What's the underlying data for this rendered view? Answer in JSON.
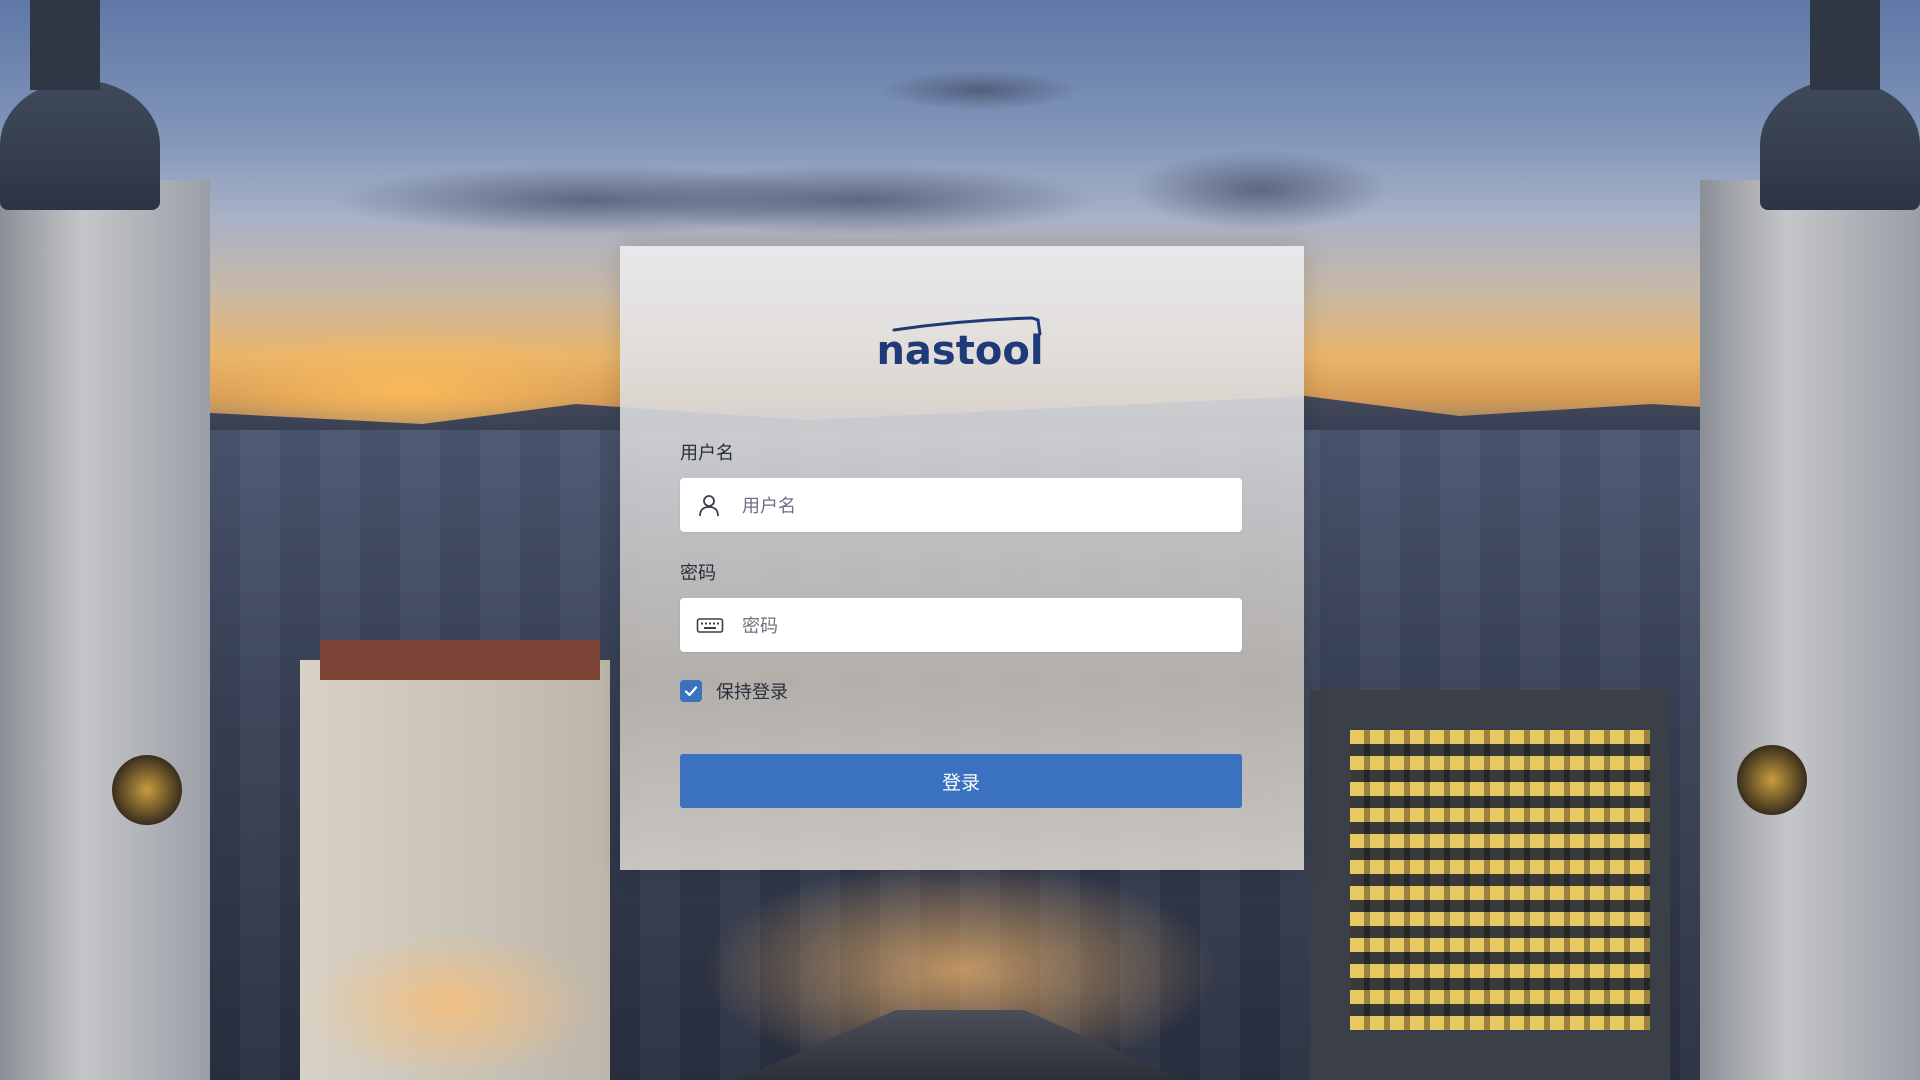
{
  "background": {
    "description_icon": "city-skyline-image"
  },
  "login": {
    "logo_text": "nastool",
    "username": {
      "label": "用户名",
      "placeholder": "用户名",
      "value": ""
    },
    "password": {
      "label": "密码",
      "placeholder": "密码",
      "value": ""
    },
    "remember": {
      "label": "保持登录",
      "checked": true
    },
    "submit_label": "登录"
  },
  "colors": {
    "accent": "#3a72c0",
    "logo": "#1f3a78"
  }
}
